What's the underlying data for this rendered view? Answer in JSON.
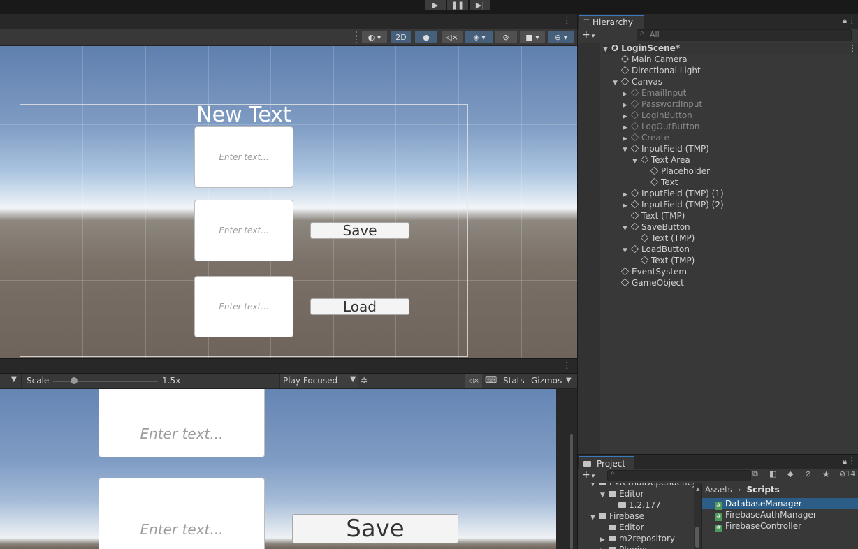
{
  "colors": {
    "accent": "#3a79bb",
    "selection": "#2c5d87"
  },
  "scene": {
    "toolbar": {
      "mode_2d": "2D"
    },
    "title_text": "New Text",
    "placeholder": "Enter text...",
    "save_label": "Save",
    "load_label": "Load"
  },
  "game": {
    "toolbar": {
      "scale_label": "Scale",
      "scale_value": "1.5x",
      "scale_fraction": 0.2,
      "play_mode": "Play Focused",
      "stats": "Stats",
      "gizmos": "Gizmos"
    },
    "placeholder": "Enter text...",
    "save_label": "Save"
  },
  "hierarchy": {
    "tab": "Hierarchy",
    "search_placeholder": "All",
    "scene_name": "LoginScene*",
    "items": [
      {
        "label": "Main Camera",
        "arrow": ""
      },
      {
        "label": "Directional Light",
        "arrow": ""
      },
      {
        "label": "Canvas",
        "arrow": "▼"
      },
      {
        "label": "EmailInput",
        "arrow": "▶"
      },
      {
        "label": "PasswordInput",
        "arrow": "▶"
      },
      {
        "label": "LogInButton",
        "arrow": "▶"
      },
      {
        "label": "LogOutButton",
        "arrow": "▶"
      },
      {
        "label": "Create",
        "arrow": "▶"
      },
      {
        "label": "InputField (TMP)",
        "arrow": "▼"
      },
      {
        "label": "Text Area",
        "arrow": "▼"
      },
      {
        "label": "Placeholder",
        "arrow": ""
      },
      {
        "label": "Text",
        "arrow": ""
      },
      {
        "label": "InputField (TMP) (1)",
        "arrow": "▶"
      },
      {
        "label": "InputField (TMP) (2)",
        "arrow": "▶"
      },
      {
        "label": "Text (TMP)",
        "arrow": ""
      },
      {
        "label": "SaveButton",
        "arrow": "▼"
      },
      {
        "label": "Text (TMP)",
        "arrow": ""
      },
      {
        "label": "LoadButton",
        "arrow": "▼"
      },
      {
        "label": "Text (TMP)",
        "arrow": ""
      },
      {
        "label": "EventSystem",
        "arrow": ""
      },
      {
        "label": "GameObject",
        "arrow": ""
      }
    ]
  },
  "project": {
    "tab": "Project",
    "breadcrumb": [
      "Assets",
      "Scripts"
    ],
    "tree": [
      {
        "label": "ExternalDependency",
        "arrow": "▼"
      },
      {
        "label": "Editor",
        "arrow": "▼"
      },
      {
        "label": "1.2.177",
        "arrow": ""
      },
      {
        "label": "Firebase",
        "arrow": "▼"
      },
      {
        "label": "Editor",
        "arrow": ""
      },
      {
        "label": "m2repository",
        "arrow": "▶"
      },
      {
        "label": "Plugins",
        "arrow": "▶"
      }
    ],
    "files": [
      "DatabaseManager",
      "FirebaseAuthManager",
      "FirebaseController"
    ],
    "hidden_count": "14"
  }
}
